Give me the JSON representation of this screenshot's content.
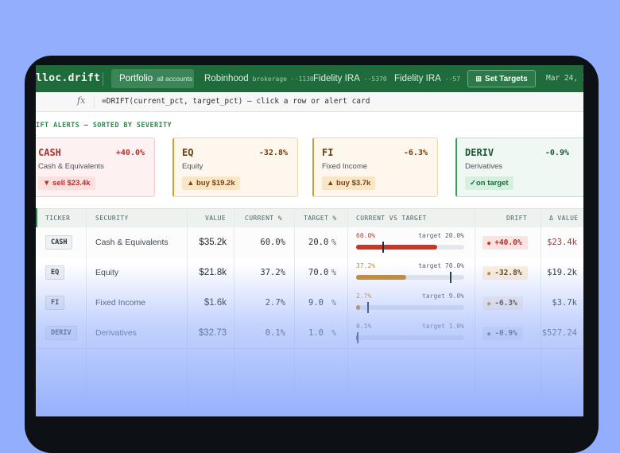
{
  "app": {
    "brand": "lloc.drift",
    "tabs": [
      {
        "name": "Portfolio",
        "sub": "all accounts"
      },
      {
        "name": "Robinhood",
        "sub": "brokerage ··1130"
      },
      {
        "name": "Fidelity IRA",
        "sub": "··5370"
      },
      {
        "name": "Fidelity IRA",
        "sub": "··57"
      }
    ],
    "set_targets": "Set Targets",
    "set_targets_icon": "grid-icon",
    "date": "Mar 24, 2"
  },
  "formula_bar": {
    "fx": "fx",
    "formula": "=DRIFT(current_pct, target_pct) — click a row or alert card"
  },
  "alerts": {
    "title": "IFT ALERTS — SORTED BY SEVERITY",
    "cards": [
      {
        "code": "CASH",
        "drift": "+40.0%",
        "name": "Cash & Equivalents",
        "action": "▼ sell $23.4k"
      },
      {
        "code": "EQ",
        "drift": "-32.8%",
        "name": "Equity",
        "action": "▲ buy $19.2k"
      },
      {
        "code": "FI",
        "drift": "-6.3%",
        "name": "Fixed Income",
        "action": "▲ buy $3.7k"
      },
      {
        "code": "DERIV",
        "drift": "-0.9%",
        "name": "Derivatives",
        "action": "✓on target"
      }
    ]
  },
  "table": {
    "headers": {
      "ticker": "TICKER",
      "security": "SECURITY",
      "value": "VALUE",
      "current": "CURRENT %",
      "target": "TARGET %",
      "cvt": "CURRENT VS TARGET",
      "drift": "DRIFT",
      "dvalue": "Δ VALUE"
    },
    "rows": [
      {
        "ticker": "CASH",
        "security": "Cash & Equivalents",
        "value": "$35.2k",
        "current": "60.0%",
        "target": "20.0",
        "target_unit": "%",
        "bar_cur_label": "60.0%",
        "bar_tgt_label": "target 20.0%",
        "current_fraction": 0.6,
        "target_fraction": 0.2,
        "bar_scale_max": 0.8,
        "drift": "+40.0%",
        "delta": "$23.4k"
      },
      {
        "ticker": "EQ",
        "security": "Equity",
        "value": "$21.8k",
        "current": "37.2%",
        "target": "70.0",
        "target_unit": "%",
        "bar_cur_label": "37.2%",
        "bar_tgt_label": "target 70.0%",
        "current_fraction": 0.372,
        "target_fraction": 0.7,
        "bar_scale_max": 0.8,
        "drift": "-32.8%",
        "delta": "$19.2k"
      },
      {
        "ticker": "FI",
        "security": "Fixed Income",
        "value": "$1.6k",
        "current": "2.7%",
        "target": "9.0",
        "target_unit": "%",
        "bar_cur_label": "2.7%",
        "bar_tgt_label": "target 9.0%",
        "current_fraction": 0.027,
        "target_fraction": 0.09,
        "bar_scale_max": 0.8,
        "drift": "-6.3%",
        "delta": "$3.7k"
      },
      {
        "ticker": "DERIV",
        "security": "Derivatives",
        "value": "$32.73",
        "current": "0.1%",
        "target": "1.0",
        "target_unit": "%",
        "bar_cur_label": "0.1%",
        "bar_tgt_label": "target 1.0%",
        "current_fraction": 0.001,
        "target_fraction": 0.01,
        "bar_scale_max": 0.8,
        "drift": "-0.9%",
        "delta": "$527.24"
      }
    ]
  },
  "colors": {
    "brand_green": "#1f6b3c",
    "accent_green": "#2f8a51",
    "red": "#c0392b",
    "amber": "#c48a2c",
    "neutral": "#4a5563",
    "background": "#93aefc"
  }
}
